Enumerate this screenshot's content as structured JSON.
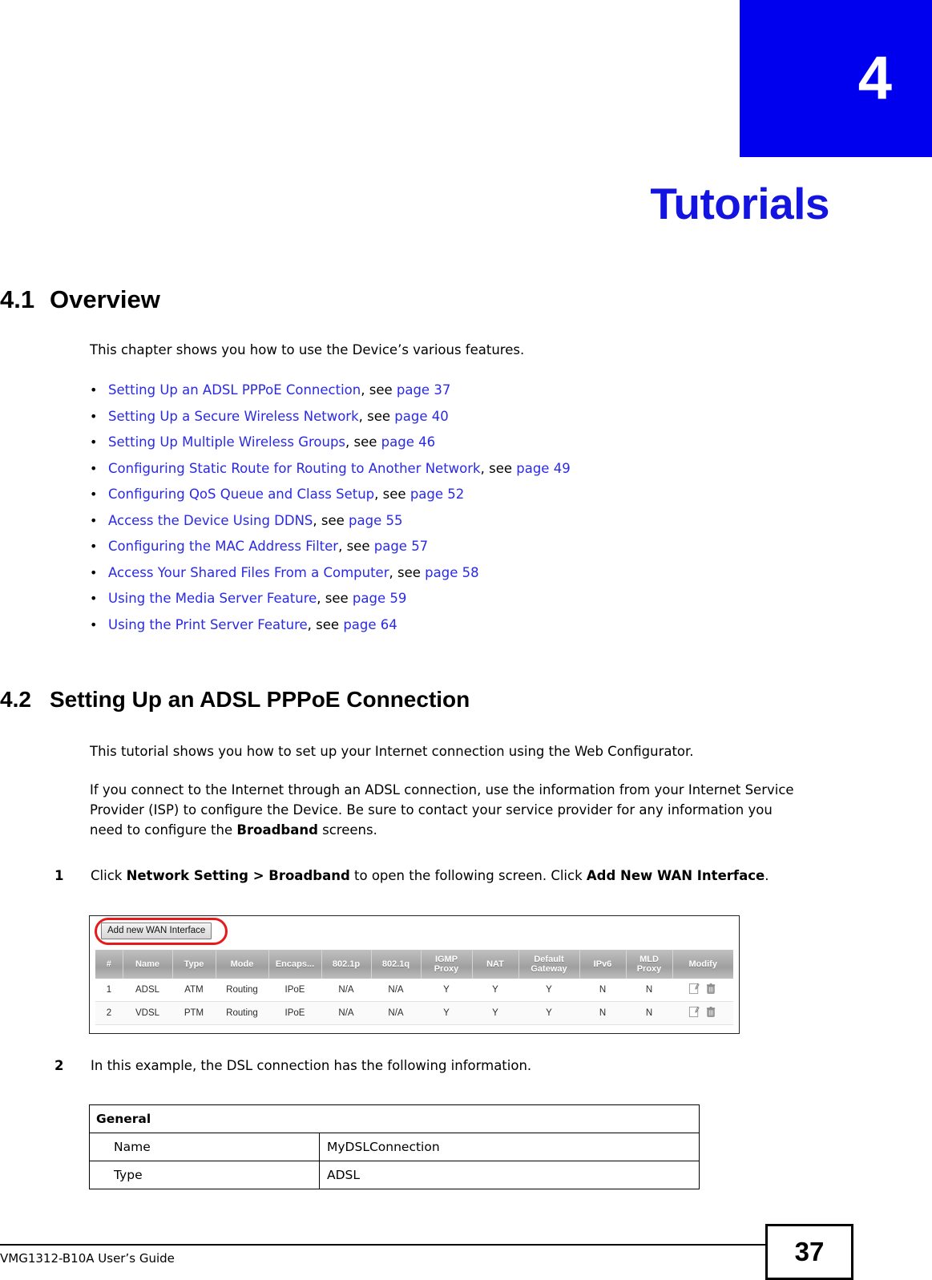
{
  "chapter": {
    "number": "4",
    "title": "Tutorials",
    "banner_color": "#0000ee",
    "title_color": "#1414e0"
  },
  "sections": {
    "overview": {
      "number": "4.1",
      "title": "Overview",
      "intro": "This chapter shows you how to use the Device’s various features.",
      "links": [
        {
          "bullet": "•",
          "title": "Setting Up an ADSL PPPoE Connection",
          "see": ", see ",
          "page": "page 37"
        },
        {
          "bullet": "•",
          "title": "Setting Up a Secure Wireless Network",
          "see": ", see ",
          "page": "page 40"
        },
        {
          "bullet": "•",
          "title": "Setting Up Multiple Wireless Groups",
          "see": ", see ",
          "page": "page 46"
        },
        {
          "bullet": "•",
          "title": "Configuring Static Route for Routing to Another Network",
          "see": ", see ",
          "page": "page 49"
        },
        {
          "bullet": "•",
          "title": "Configuring QoS Queue and Class Setup",
          "see": ", see ",
          "page": "page 52"
        },
        {
          "bullet": "•",
          "title": "Access the Device Using DDNS",
          "see": ", see ",
          "page": "page 55"
        },
        {
          "bullet": "•",
          "title": "Configuring the MAC Address Filter",
          "see": ", see ",
          "page": "page 57"
        },
        {
          "bullet": "•",
          "title": "Access Your Shared Files From a Computer",
          "see": ", see ",
          "page": "page 58"
        },
        {
          "bullet": "•",
          "title": "Using the Media Server Feature",
          "see": ", see ",
          "page": "page 59"
        },
        {
          "bullet": "•",
          "title": "Using the Print Server Feature",
          "see": ", see ",
          "page": "page 64"
        }
      ]
    },
    "tutorial": {
      "number": "4.2",
      "title": "Setting Up an ADSL PPPoE Connection",
      "para1": "This tutorial shows you how to set up your Internet connection using the Web Configurator.",
      "para2_a": "If you connect to the Internet through an ADSL connection, use the information from your Internet Service Provider (ISP) to configure the Device. Be sure to contact your service provider for any information you need to configure the ",
      "para2_bold": "Broadband",
      "para2_b": " screens."
    }
  },
  "steps": [
    {
      "number": "1",
      "text_a": "Click ",
      "bold_a": "Network Setting > Broadband",
      "text_b": " to open the following screen. Click ",
      "bold_b": "Add New WAN Interface",
      "text_c": "."
    },
    {
      "number": "2",
      "text_a": "In this example, the DSL connection has the following information.",
      "bold_a": "",
      "text_b": "",
      "bold_b": "",
      "text_c": ""
    }
  ],
  "wan_screenshot": {
    "add_button_label": "Add new WAN Interface",
    "highlight_color": "#e8191a",
    "columns": [
      "#",
      "Name",
      "Type",
      "Mode",
      "Encaps...",
      "802.1p",
      "802.1q",
      "IGMP Proxy",
      "NAT",
      "Default Gateway",
      "IPv6",
      "MLD Proxy",
      "Modify"
    ],
    "rows": [
      {
        "num": "1",
        "name": "ADSL",
        "type": "ATM",
        "mode": "Routing",
        "encaps": "IPoE",
        "dot1p": "N/A",
        "dot1q": "N/A",
        "igmp": "Y",
        "nat": "Y",
        "gateway": "Y",
        "ipv6": "N",
        "mld": "N"
      },
      {
        "num": "2",
        "name": "VDSL",
        "type": "PTM",
        "mode": "Routing",
        "encaps": "IPoE",
        "dot1p": "N/A",
        "dot1q": "N/A",
        "igmp": "Y",
        "nat": "Y",
        "gateway": "Y",
        "ipv6": "N",
        "mld": "N"
      }
    ]
  },
  "general_table": {
    "header": "General",
    "rows": [
      {
        "label": "Name",
        "value": "MyDSLConnection"
      },
      {
        "label": "Type",
        "value": "ADSL"
      }
    ]
  },
  "footer": {
    "guide_name": "VMG1312-B10A User’s Guide",
    "page_number": "37"
  }
}
